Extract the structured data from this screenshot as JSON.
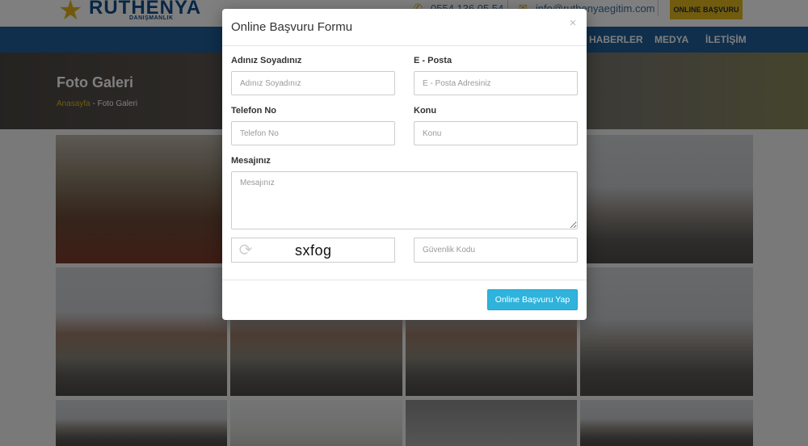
{
  "header": {
    "logo_text": "RUTHENYA",
    "logo_sub": "DANIŞMANLIK",
    "phone": "0554 136 05 54",
    "email": "info@ruthenyaegitim.com",
    "apply_button": "ONLINE BAŞVURU"
  },
  "nav": {
    "items": [
      "HABERLER",
      "MEDYA",
      "İLETİŞİM"
    ]
  },
  "hero": {
    "title": "Foto Galeri",
    "breadcrumb_home": "Anasayfa",
    "breadcrumb_sep": " - ",
    "breadcrumb_current": "Foto Galeri"
  },
  "modal": {
    "title": "Online Başvuru Formu",
    "close": "×",
    "name_label": "Adınız Soyadınız",
    "name_placeholder": "Adınız Soyadınız",
    "email_label": "E - Posta",
    "email_placeholder": "E - Posta Adresiniz",
    "phone_label": "Telefon No",
    "phone_placeholder": "Telefon No",
    "subject_label": "Konu",
    "subject_placeholder": "Konu",
    "message_label": "Mesajınız",
    "message_placeholder": "Mesajınız",
    "captcha_code": "sxfog",
    "security_placeholder": "Güvenlik Kodu",
    "submit": "Online Başvuru Yap"
  },
  "colors": {
    "brand_blue": "#1f5f99",
    "accent_yellow": "#e3b71c",
    "submit_blue": "#2fb3dc"
  },
  "icons": [
    "star-logo-icon",
    "phone-icon",
    "mail-icon",
    "close-icon",
    "refresh-icon"
  ]
}
